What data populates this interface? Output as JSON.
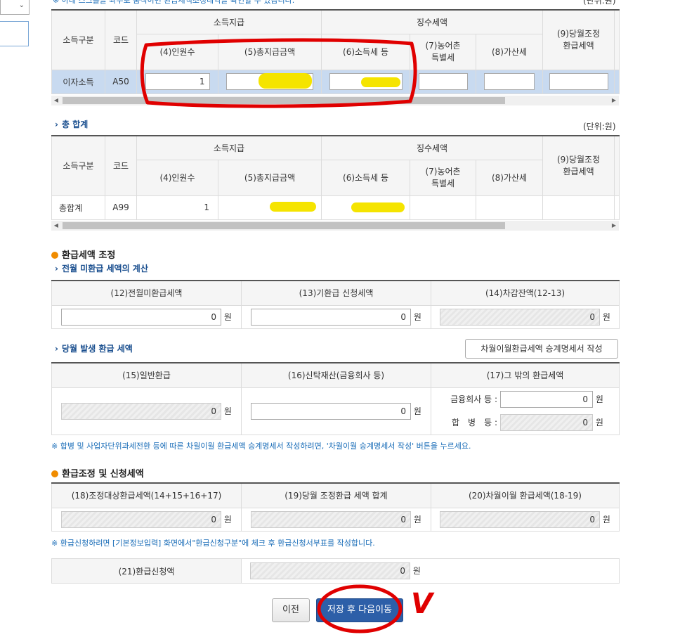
{
  "top_note": "※ 아래 스크롤을 좌우로 움직이면 환급세액조정내역을 확인할 수 있습니다.",
  "unit_label": "(단위:원)",
  "colors": {
    "accent_blue": "#2d5fa8",
    "annotation_red": "#e00000",
    "highlight_yellow": "#f5e400"
  },
  "table1": {
    "headers": {
      "income_type": "소득구분",
      "code": "코드",
      "income_payment": "소득지급",
      "tax_collected": "징수세액",
      "people": "(4)인원수",
      "total_pay": "(5)총지급금액",
      "income_tax": "(6)소득세 등",
      "rural_tax": "(7)농어촌\n특별세",
      "add_tax": "(8)가산세",
      "monthly_refund": "(9)당월조정\n환급세액"
    },
    "row": {
      "type": "이자소득",
      "code": "A50",
      "people": "1"
    }
  },
  "total_section": {
    "title": "총 합계",
    "unit_label": "(단위:원)",
    "row": {
      "type": "총합계",
      "code": "A99",
      "people": "1"
    }
  },
  "refund_adjust": {
    "title": "환급세액 조정",
    "prev_month": {
      "title": "전월 미환급 세액의 계산",
      "col12": "(12)전월미환급세액",
      "col13": "(13)기환급 신청세액",
      "col14": "(14)차감잔액(12-13)",
      "v12": "0",
      "v13": "0",
      "v14": "0"
    },
    "this_month": {
      "title": "당월 발생 환급 세액",
      "succession_button": "차월이월환급세액 승계명세서 작성",
      "col15": "(15)일반환급",
      "col16": "(16)신탁재산(금융회사 등)",
      "col17": "(17)그 밖의 환급세액",
      "v15": "0",
      "v16": "0",
      "financial_label": "금융회사 등 :",
      "financial_value": "0",
      "merger_label": "합　병　등 :",
      "merger_value": "0"
    },
    "note": "※ 합병 및 사업자단위과세전환 등에 따른 차월이월 환급세액 승계명세서 작성하려면, '차월이월 승계명세서 작성' 버튼을 누르세요."
  },
  "refund_request": {
    "title": "환급조정 및 신청세액",
    "col18": "(18)조정대상환급세액(14+15+16+17)",
    "col19": "(19)당월 조정환급 세액 합계",
    "col20": "(20)차월이월 환급세액(18-19)",
    "v18": "0",
    "v19": "0",
    "v20": "0",
    "note": "※ 환급신청하려면 [기본정보입력] 화면에서\"환급신청구분\"에 체크 후 환급신청서부표를 작성합니다.",
    "label21": "(21)환급신청액",
    "v21": "0"
  },
  "won": "원",
  "buttons": {
    "prev": "이전",
    "save_next": "저장 후 다음이동"
  },
  "annotation_mark": "V"
}
